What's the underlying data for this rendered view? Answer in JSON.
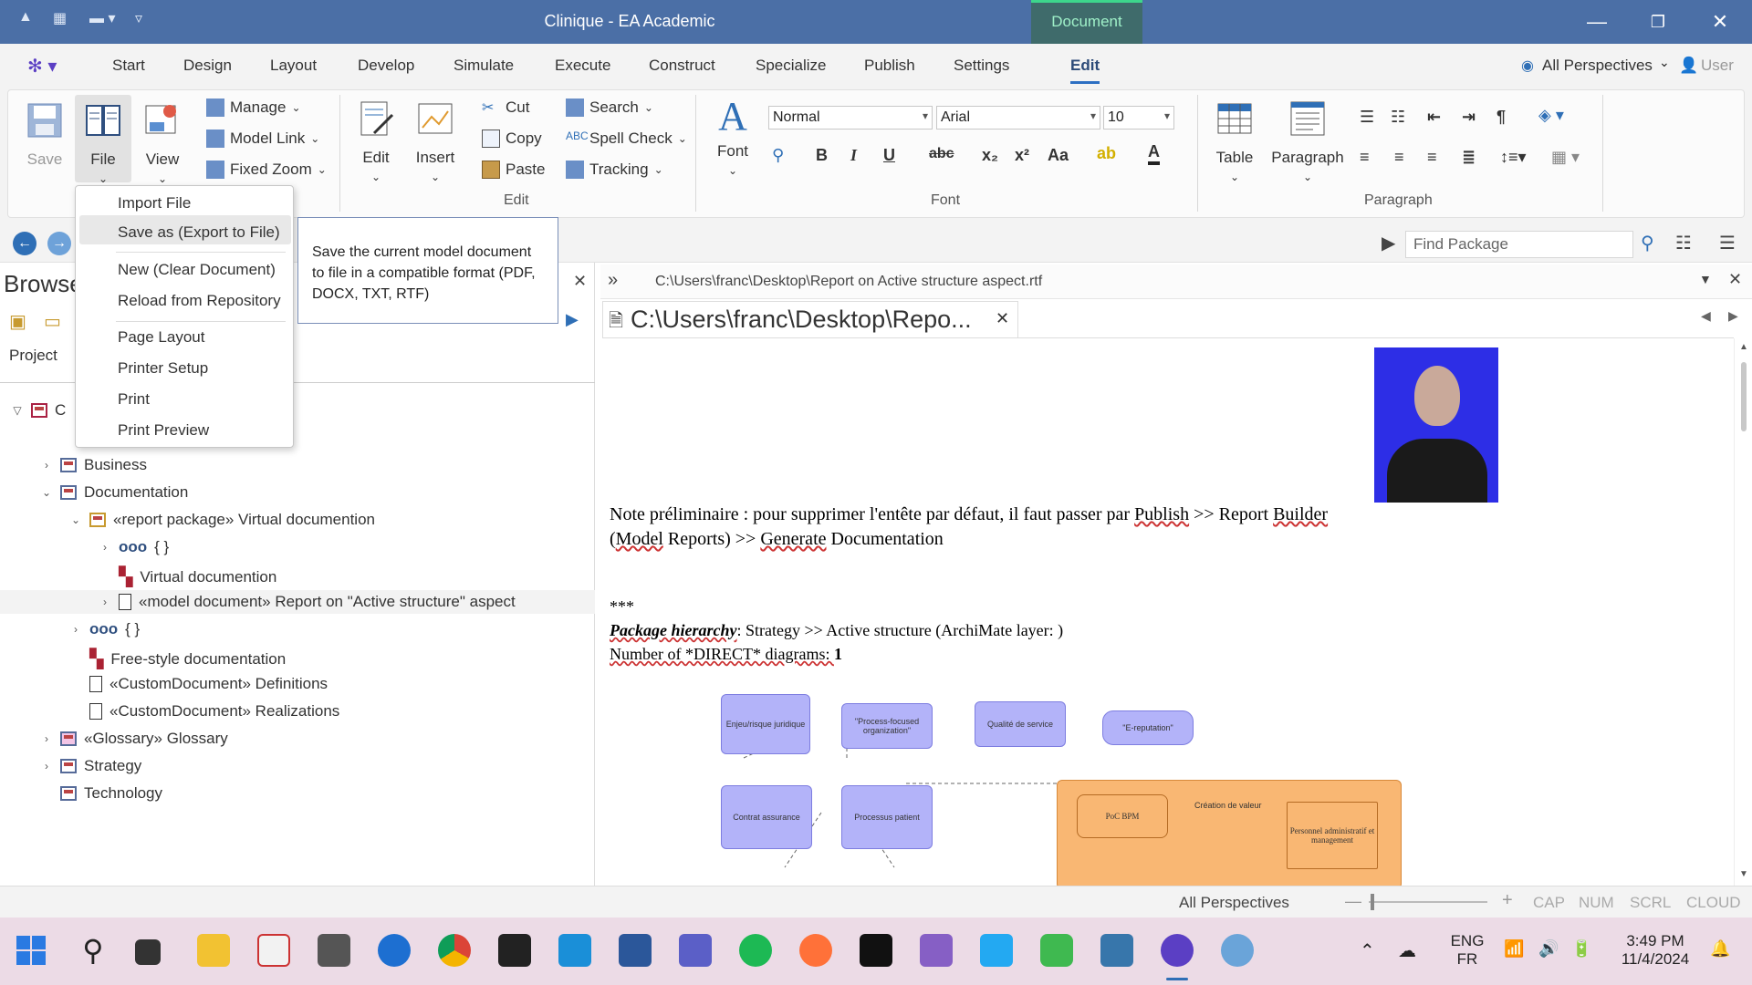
{
  "window": {
    "title": "Clinique - EA Academic",
    "context_tab": "Document"
  },
  "ribbon_tabs": [
    "Start",
    "Design",
    "Layout",
    "Develop",
    "Simulate",
    "Execute",
    "Construct",
    "Specialize",
    "Publish",
    "Settings",
    "Edit"
  ],
  "active_tab": "Edit",
  "perspectives": {
    "label": "All Perspectives",
    "user": "User"
  },
  "ribbon": {
    "save": "Save",
    "file": "File",
    "view": "View",
    "manage": "Manage",
    "model_link": "Model Link",
    "fixed_zoom": "Fixed Zoom",
    "edit": "Edit",
    "insert": "Insert",
    "cut": "Cut",
    "copy": "Copy",
    "paste": "Paste",
    "search": "Search",
    "spell_check": "Spell Check",
    "tracking": "Tracking",
    "edit_group": "Edit",
    "font": "Font",
    "style_value": "Normal",
    "font_value": "Arial",
    "size_value": "10",
    "font_group": "Font",
    "table": "Table",
    "paragraph": "Paragraph",
    "paragraph_group": "Paragraph"
  },
  "toolbar": {
    "find_placeholder": "Find Package"
  },
  "browser": {
    "title": "Browse",
    "tab_project": "Project",
    "tree": [
      {
        "label": "C",
        "level": 0
      },
      {
        "label": "Business",
        "level": 1
      },
      {
        "label": "Documentation",
        "level": 1
      },
      {
        "label": "«report package» Virtual documention",
        "level": 2
      },
      {
        "label": "{ }",
        "level": 3
      },
      {
        "label": "Virtual documention",
        "level": 3
      },
      {
        "label": "«model document» Report on \"Active structure\" aspect",
        "level": 3
      },
      {
        "label": "{ }",
        "level": 2
      },
      {
        "label": "Free-style documentation",
        "level": 2
      },
      {
        "label": "«CustomDocument» Definitions",
        "level": 2
      },
      {
        "label": "«CustomDocument» Realizations",
        "level": 2
      },
      {
        "label": "«Glossary» Glossary",
        "level": 1
      },
      {
        "label": "Strategy",
        "level": 1
      },
      {
        "label": "Technology",
        "level": 1
      }
    ]
  },
  "file_menu": {
    "items": [
      "Import File",
      "Save as (Export to File)",
      "New (Clear Document)",
      "Reload from Repository",
      "Page Layout",
      "Printer Setup",
      "Print",
      "Print Preview"
    ],
    "highlighted": "Save as (Export to File)",
    "tooltip": "Save the current model document to file in a compatible format (PDF, DOCX, TXT, RTF)"
  },
  "document": {
    "path_bar": "C:\\Users\\franc\\Desktop\\Report on Active structure aspect.rtf",
    "tab_label": "C:\\Users\\franc\\Desktop\\Repo...",
    "note_line1_a": "Note préliminaire : pour supprimer l'entête par défaut, il faut passer par ",
    "note_publish": "Publish",
    "note_line1_b": " >> Report ",
    "note_builder": "Builder",
    "note_line2_a": "(",
    "note_model": "Model",
    "note_line2_b": " Reports) >> ",
    "note_generate": "Generate",
    "note_line2_c": " Documentation",
    "stars": "***",
    "hierarchy_label": "Package hierarchy",
    "hierarchy_value": ": Strategy >> Active structure (ArchiMate layer: )",
    "direct_label": "Number of *DIRECT* diagrams: ",
    "direct_value": "1",
    "diagram_nodes": [
      "Enjeu/risque juridique",
      "\"Process-focused organization\"",
      "Qualité de service",
      "\"E-reputation\"",
      "Contrat assurance",
      "Processus patient",
      "Création de valeur",
      "PoC BPM",
      "Personnel administratif et management"
    ]
  },
  "status": {
    "perspectives": "All Perspectives",
    "cap": "CAP",
    "num": "NUM",
    "scrl": "SCRL",
    "cloud": "CLOUD"
  },
  "taskbar": {
    "lang1": "ENG",
    "lang2": "FR",
    "time": "3:49 PM",
    "date": "11/4/2024"
  }
}
